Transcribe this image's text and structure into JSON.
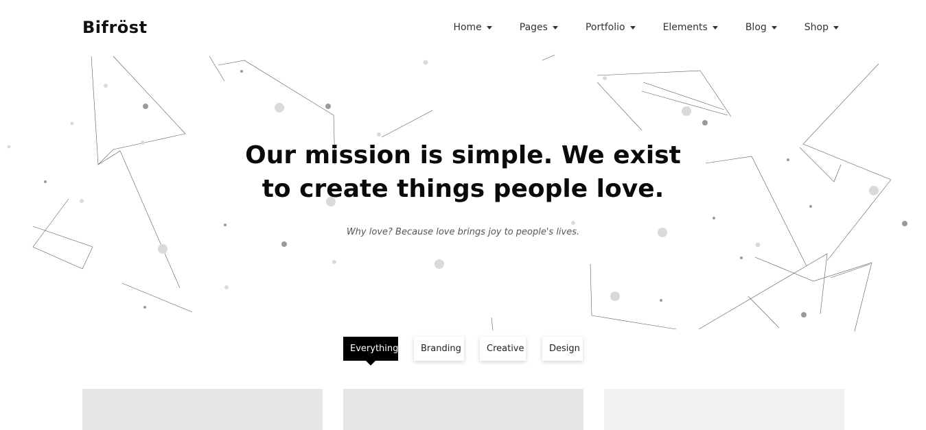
{
  "brand": {
    "logo": "Bifröst"
  },
  "nav": {
    "items": [
      {
        "label": "Home"
      },
      {
        "label": "Pages"
      },
      {
        "label": "Portfolio"
      },
      {
        "label": "Elements"
      },
      {
        "label": "Blog"
      },
      {
        "label": "Shop"
      }
    ]
  },
  "hero": {
    "title_line1": "Our mission is simple. We exist",
    "title_line2": "to create things people love.",
    "subtitle": "Why love? Because love brings joy to people's lives."
  },
  "filters": {
    "items": [
      {
        "label": "Everything",
        "active": true
      },
      {
        "label": "Branding",
        "active": false
      },
      {
        "label": "Creative",
        "active": false
      },
      {
        "label": "Design",
        "active": false
      }
    ]
  },
  "portfolio": {
    "cards": [
      {
        "name": "portfolio-item-1",
        "color": "#e6e6e6"
      },
      {
        "name": "portfolio-item-2",
        "color": "#e6e6e6"
      },
      {
        "name": "portfolio-item-3",
        "color": "#f2f1f1"
      }
    ]
  },
  "colors": {
    "background": "#ffffff",
    "text": "#111111",
    "active_filter": "#000000",
    "card_placeholder": "#e6e6e6"
  }
}
